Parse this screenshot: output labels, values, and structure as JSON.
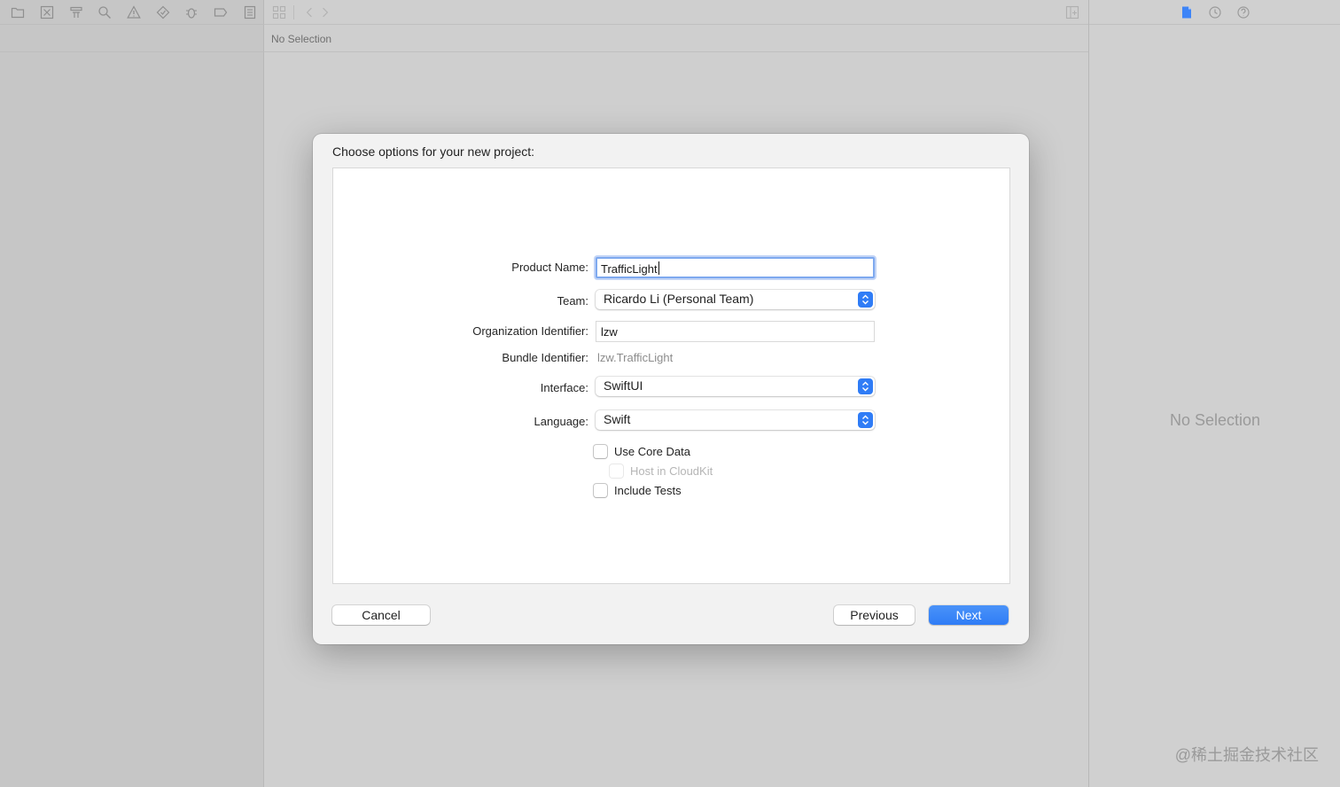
{
  "navigator": {
    "toolbar_icons": [
      "folder-icon",
      "source-control-icon",
      "symbol-icon",
      "find-icon",
      "warning-icon",
      "test-icon",
      "debug-icon",
      "breakpoint-icon",
      "report-icon"
    ]
  },
  "editor": {
    "jump_bar_text": "No Selection"
  },
  "inspector": {
    "empty_text": "No Selection",
    "icons": [
      "file-inspector-icon",
      "history-icon",
      "help-icon"
    ]
  },
  "dialog": {
    "title": "Choose options for your new project:",
    "fields": {
      "product_name_label": "Product Name:",
      "product_name_value": "TrafficLight",
      "team_label": "Team:",
      "team_value": "Ricardo Li (Personal Team)",
      "org_label": "Organization Identifier:",
      "org_value": "lzw",
      "bundle_label": "Bundle Identifier:",
      "bundle_value": "lzw.TrafficLight",
      "interface_label": "Interface:",
      "interface_value": "SwiftUI",
      "language_label": "Language:",
      "language_value": "Swift"
    },
    "checkboxes": {
      "core_data": "Use Core Data",
      "cloudkit": "Host in CloudKit",
      "tests": "Include Tests"
    },
    "buttons": {
      "cancel": "Cancel",
      "previous": "Previous",
      "next": "Next"
    },
    "accent_color": "#2f7cf6"
  },
  "watermark": "@稀土掘金技术社区"
}
